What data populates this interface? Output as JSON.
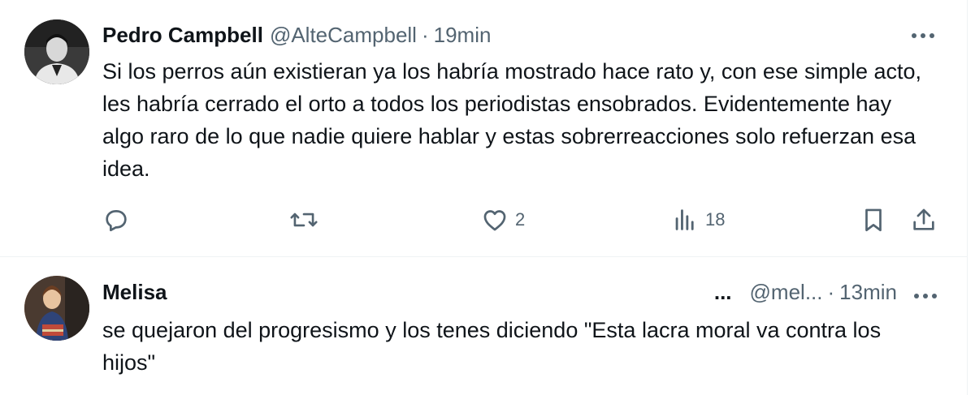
{
  "tweets": [
    {
      "author_name": "Pedro Campbell",
      "handle": "@AlteCampbell",
      "separator": "·",
      "time": "19min",
      "text": "Si los perros aún existieran ya los habría mostrado hace rato y, con ese simple acto, les habría cerrado el orto a todos los periodistas ensobrados. Evidentemente hay algo raro de lo que nadie quiere hablar y estas sobrerreacciones solo refuerzan esa idea.",
      "actions": {
        "reply": {
          "icon": "reply-icon",
          "count": ""
        },
        "retweet": {
          "icon": "retweet-icon",
          "count": ""
        },
        "like": {
          "icon": "heart-icon",
          "count": "2"
        },
        "views": {
          "icon": "views-icon",
          "count": "18"
        },
        "bookmark": {
          "icon": "bookmark-icon"
        },
        "share": {
          "icon": "share-icon"
        }
      }
    },
    {
      "author_name": "Melisa",
      "name_overflow": "...",
      "handle": "@mel...",
      "separator": "·",
      "time": "13min",
      "text": "se quejaron del progresismo y los tenes diciendo \"Esta lacra moral va contra los hijos\""
    }
  ],
  "colors": {
    "text_primary": "#0f1419",
    "text_secondary": "#536471",
    "divider": "#eff3f4"
  }
}
